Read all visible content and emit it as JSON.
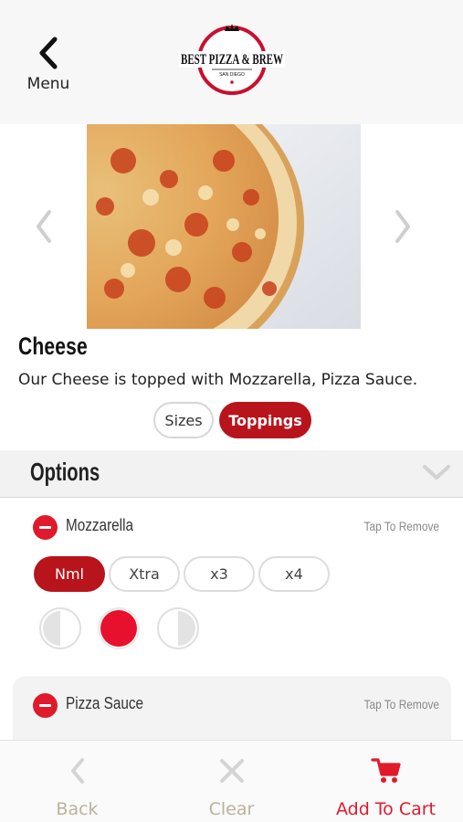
{
  "header": {
    "menu_label": "Menu",
    "logo": {
      "line1": "BEST PIZZA & BREW",
      "line2": "SAN DIEGO",
      "ring_color": "#c8102e"
    }
  },
  "item": {
    "title": "Cheese",
    "description": "Our Cheese is topped with Mozzarella, Pizza Sauce.",
    "tabs": [
      {
        "label": "Sizes",
        "selected": false
      },
      {
        "label": "Toppings",
        "selected": true
      }
    ]
  },
  "options": {
    "title": "Options",
    "toppings": [
      {
        "name": "Mozzarella",
        "action": "Tap To Remove",
        "amounts": [
          {
            "label": "Nml",
            "selected": true
          },
          {
            "label": "Xtra",
            "selected": false
          },
          {
            "label": "x3",
            "selected": false
          },
          {
            "label": "x4",
            "selected": false
          }
        ],
        "coverage": [
          {
            "name": "left-half",
            "selected": false
          },
          {
            "name": "whole",
            "selected": true
          },
          {
            "name": "right-half",
            "selected": false
          }
        ]
      },
      {
        "name": "Pizza Sauce",
        "action": "Tap To Remove"
      }
    ]
  },
  "bottom_bar": {
    "back_label": "Back",
    "clear_label": "Clear",
    "cart_label": "Add To Cart"
  },
  "colors": {
    "accent": "#b8141c",
    "remove_red": "#e01a2b",
    "muted_label": "#b9b39d"
  }
}
